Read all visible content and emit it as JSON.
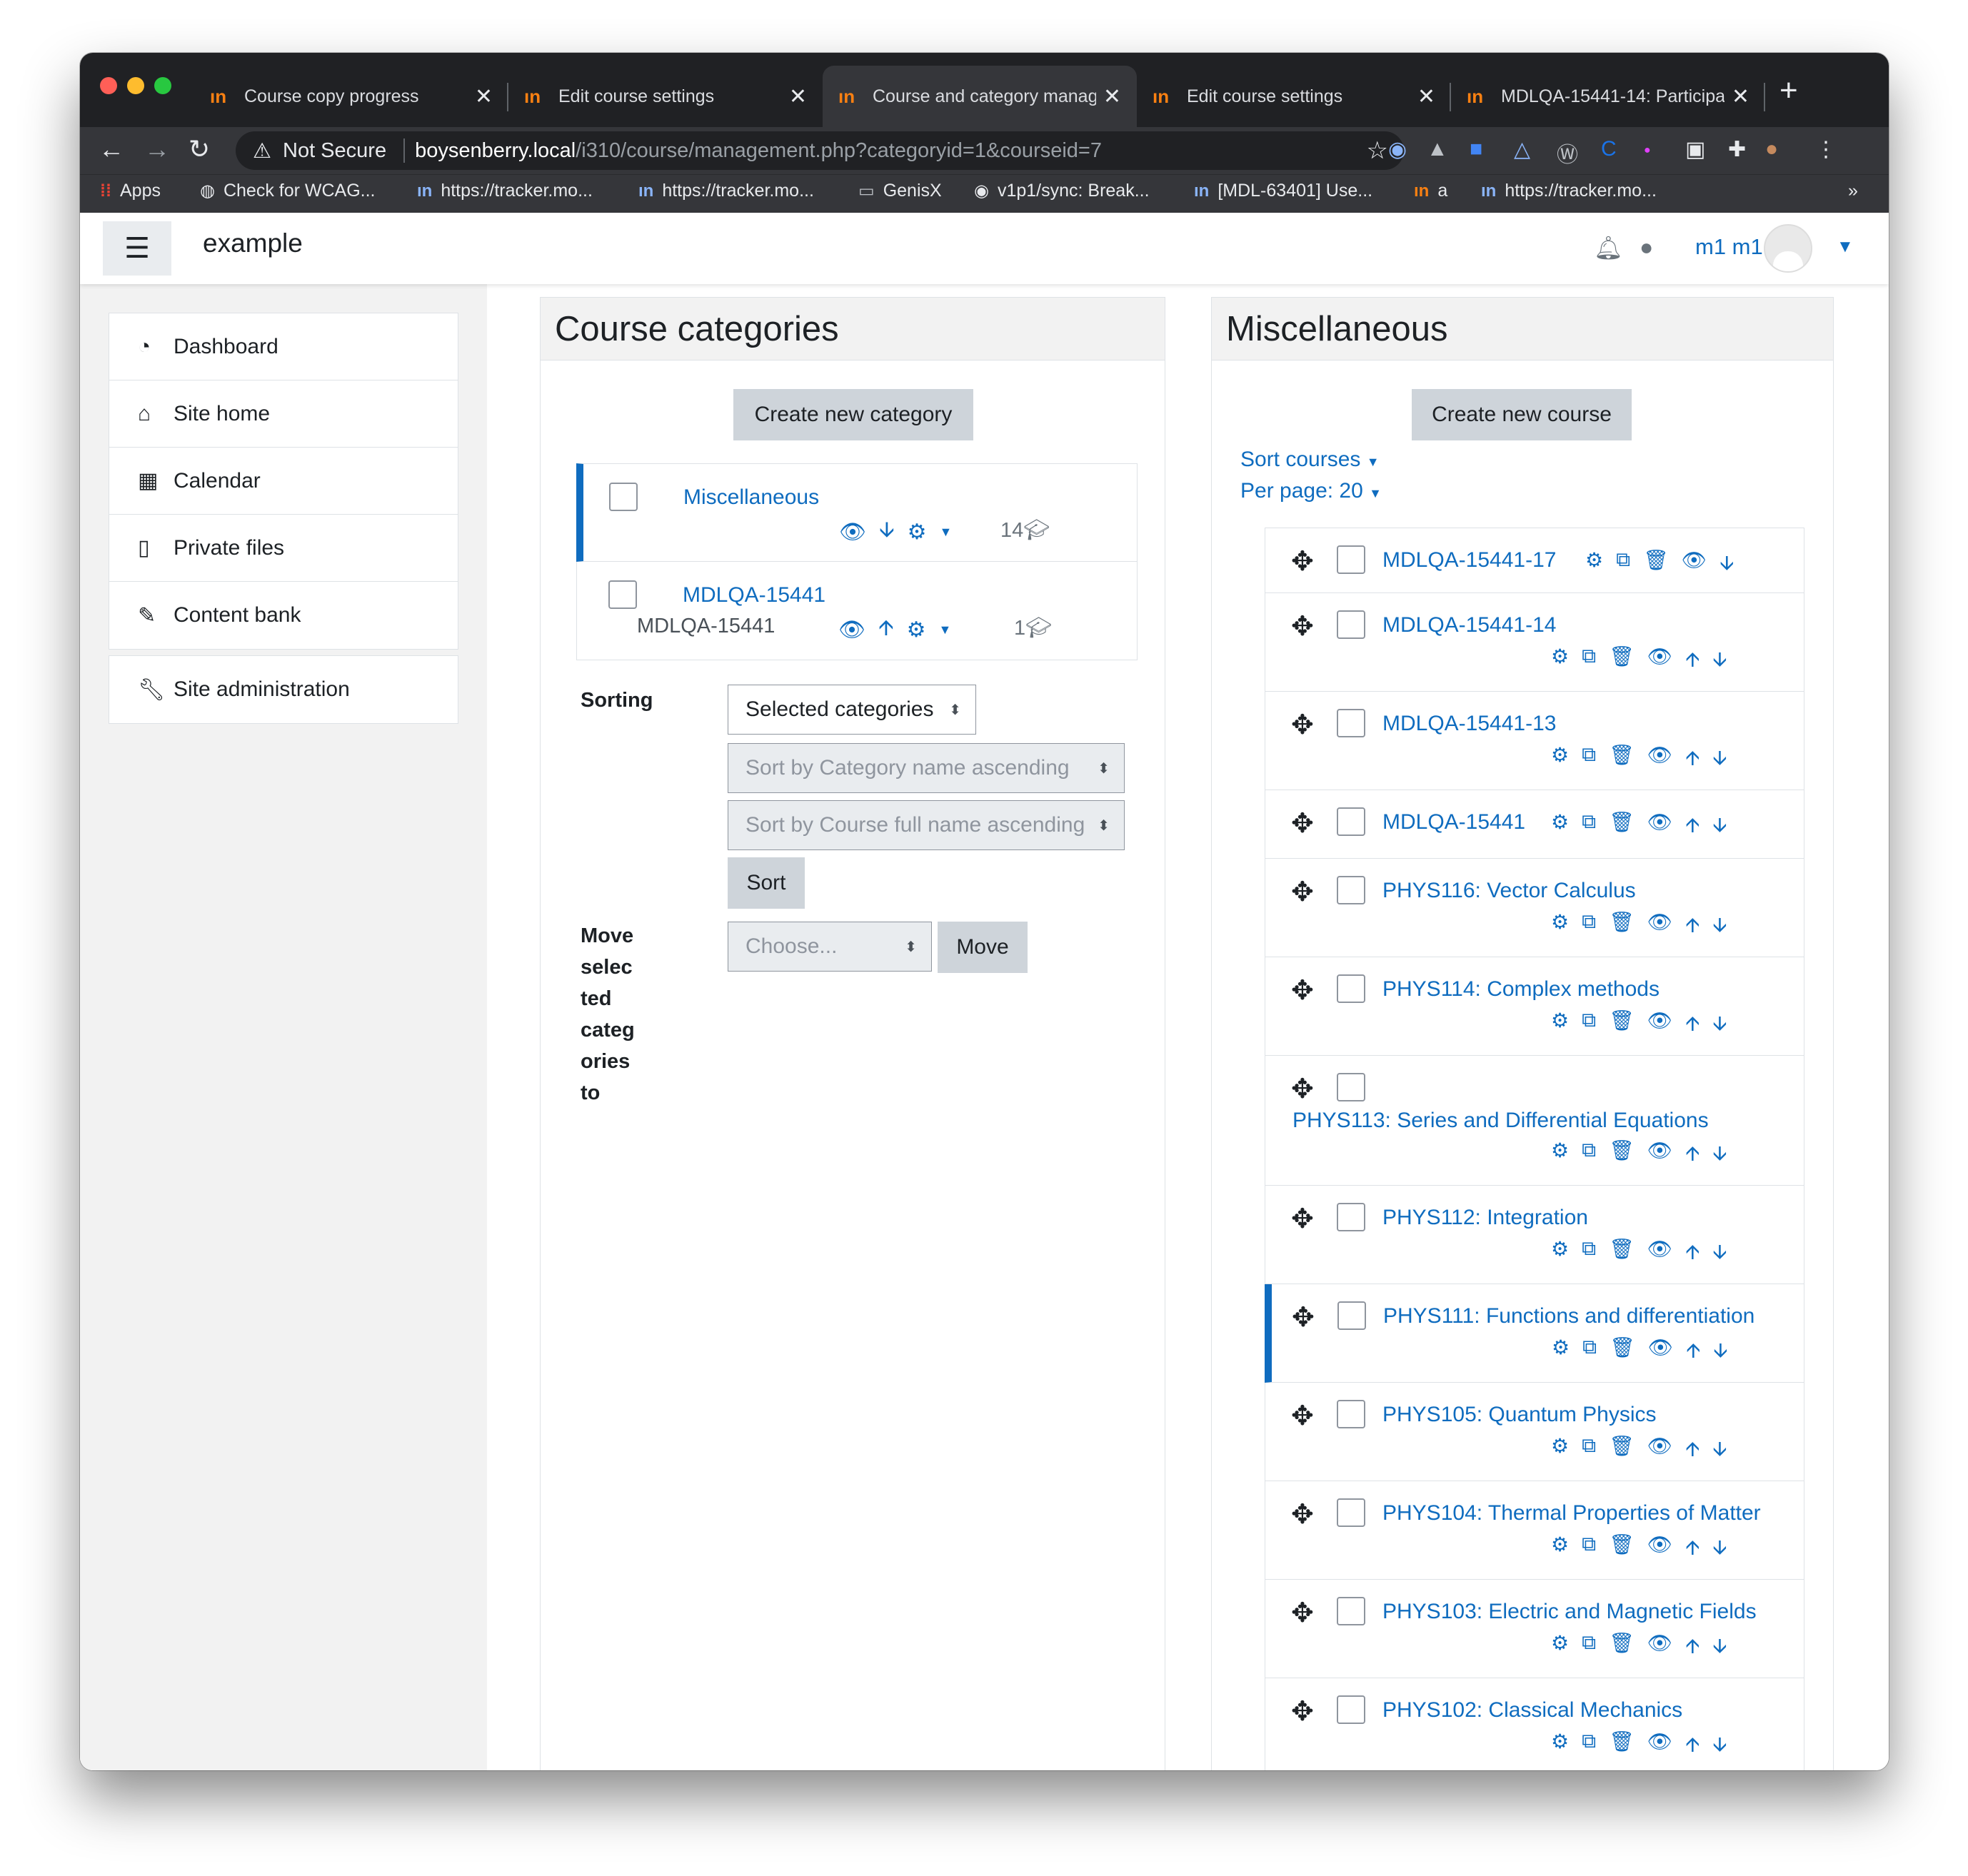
{
  "browser": {
    "tabs": [
      {
        "title": "Course copy progress"
      },
      {
        "title": "Edit course settings"
      },
      {
        "title": "Course and category manag"
      },
      {
        "title": "Edit course settings"
      },
      {
        "title": "MDLQA-15441-14: Participa"
      }
    ],
    "security": "Not Secure",
    "url_host": "boysenberry.local",
    "url_path": "/i310/course/management.php?categoryid=1&courseid=7",
    "bookmarks": [
      {
        "label": "Apps"
      },
      {
        "label": "Check for WCAG..."
      },
      {
        "label": "https://tracker.mo..."
      },
      {
        "label": "https://tracker.mo..."
      },
      {
        "label": "GenisX"
      },
      {
        "label": "v1p1/sync: Break..."
      },
      {
        "label": "[MDL-63401] Use..."
      },
      {
        "label": "a"
      },
      {
        "label": "https://tracker.mo..."
      }
    ],
    "more": "»"
  },
  "topbar": {
    "site_name": "example",
    "user_name": "m1 m1"
  },
  "nav": {
    "items": [
      {
        "label": "Dashboard",
        "icon": "tachometer-icon"
      },
      {
        "label": "Site home",
        "icon": "home-icon"
      },
      {
        "label": "Calendar",
        "icon": "calendar-icon"
      },
      {
        "label": "Private files",
        "icon": "file-icon"
      },
      {
        "label": "Content bank",
        "icon": "paint-brush-icon"
      }
    ],
    "admin": {
      "label": "Site administration",
      "icon": "wrench-icon"
    }
  },
  "categories_panel": {
    "title": "Course categories",
    "create_button": "Create new category",
    "categories": [
      {
        "name": "Miscellaneous",
        "idnumber": "",
        "count": "14"
      },
      {
        "name": "MDLQA-15441",
        "idnumber": "MDLQA-15441",
        "count": "1"
      }
    ],
    "sorting_label": "Sorting",
    "sort_scope": "Selected categories",
    "sort_category": "Sort by Category name ascending",
    "sort_course": "Sort by Course full name ascending",
    "sort_button": "Sort",
    "move_label": "Move selected categories to",
    "move_label_lines": [
      "Move",
      "selec",
      "ted",
      "categ",
      "ories",
      "to"
    ],
    "move_choose": "Choose...",
    "move_button": "Move"
  },
  "courses_panel": {
    "title": "Miscellaneous",
    "create_button": "Create new course",
    "sort_courses": "Sort courses",
    "per_page": "Per page: 20",
    "courses": [
      {
        "name": "MDLQA-15441-17"
      },
      {
        "name": "MDLQA-15441-14"
      },
      {
        "name": "MDLQA-15441-13"
      },
      {
        "name": "MDLQA-15441"
      },
      {
        "name": "PHYS116: Vector Calculus"
      },
      {
        "name": "PHYS114: Complex methods"
      },
      {
        "name": "PHYS113: Series and Differential Equations"
      },
      {
        "name": "PHYS112: Integration"
      },
      {
        "name": "PHYS111: Functions and differentiation"
      },
      {
        "name": "PHYS105: Quantum Physics"
      },
      {
        "name": "PHYS104: Thermal Properties of Matter"
      },
      {
        "name": "PHYS103: Electric and Magnetic Fields"
      },
      {
        "name": "PHYS102: Classical Mechanics"
      }
    ]
  },
  "colors": {
    "link": "#0f6cbf",
    "accent_bar": "#0f6cbf",
    "moodle_orange": "#f98012"
  }
}
